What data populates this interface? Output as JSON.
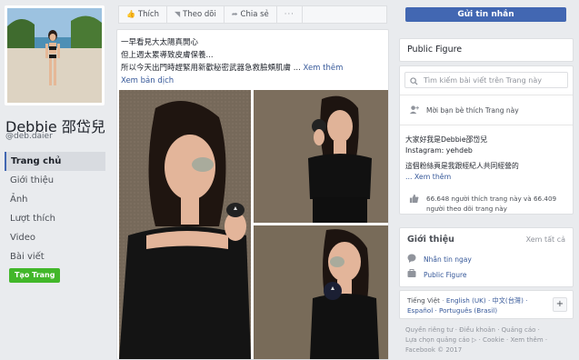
{
  "profile": {
    "name": "Debbie 邵岱兒",
    "handle": "@deb.daier",
    "nav": [
      "Trang chủ",
      "Giới thiệu",
      "Ảnh",
      "Lượt thích",
      "Video",
      "Bài viết"
    ],
    "create_page": "Tạo Trang"
  },
  "actionbar": {
    "like": "Thích",
    "follow": "Theo dõi",
    "share": "Chia sẻ",
    "more": "···"
  },
  "post": {
    "line1": "一早看見大太陽真開心",
    "line2": "但上週太累導致皮膚保養...",
    "line3": "所以今天出門時趕緊用新歡秘密武器急救臉頰肌膚 ...",
    "see_more": "Xem thêm",
    "translate": "Xem bản dịch"
  },
  "right": {
    "send_message": "Gửi tin nhắn",
    "category": "Public Figure",
    "search_placeholder": "Tìm kiếm bài viết trên Trang này",
    "invite": "Mời bạn bè thích Trang này",
    "about_line1": "大家好我是Debbie邵岱兒",
    "about_line2": "Instagram: yehdeb",
    "about_line3": "這個粉絲頁是我跟經紀人共同經營的",
    "about_see_more": "... Xem thêm",
    "likes_text": "66.648 người thích trang này và 66.409 người theo dõi trang này",
    "intro_title": "Giới thiệu",
    "intro_see_all": "Xem tất cả",
    "intro_items": [
      "Nhắn tin ngay",
      "Public Figure"
    ],
    "lang_current": "Tiếng Việt",
    "lang_options": "English (UK) · 中文(台灣) · Español · Português (Brasil)",
    "plus": "+",
    "footer_line1": "Quyền riêng tư · Điều khoản · Quảng cáo ·",
    "footer_line2": "Lựa chọn quảng cáo ▷ · Cookie · Xem thêm ·",
    "footer_line3": "Facebook © 2017"
  },
  "colors": {
    "fb_blue": "#4267b2",
    "link": "#365899",
    "green": "#42b72a",
    "background": "#e9ebee"
  }
}
